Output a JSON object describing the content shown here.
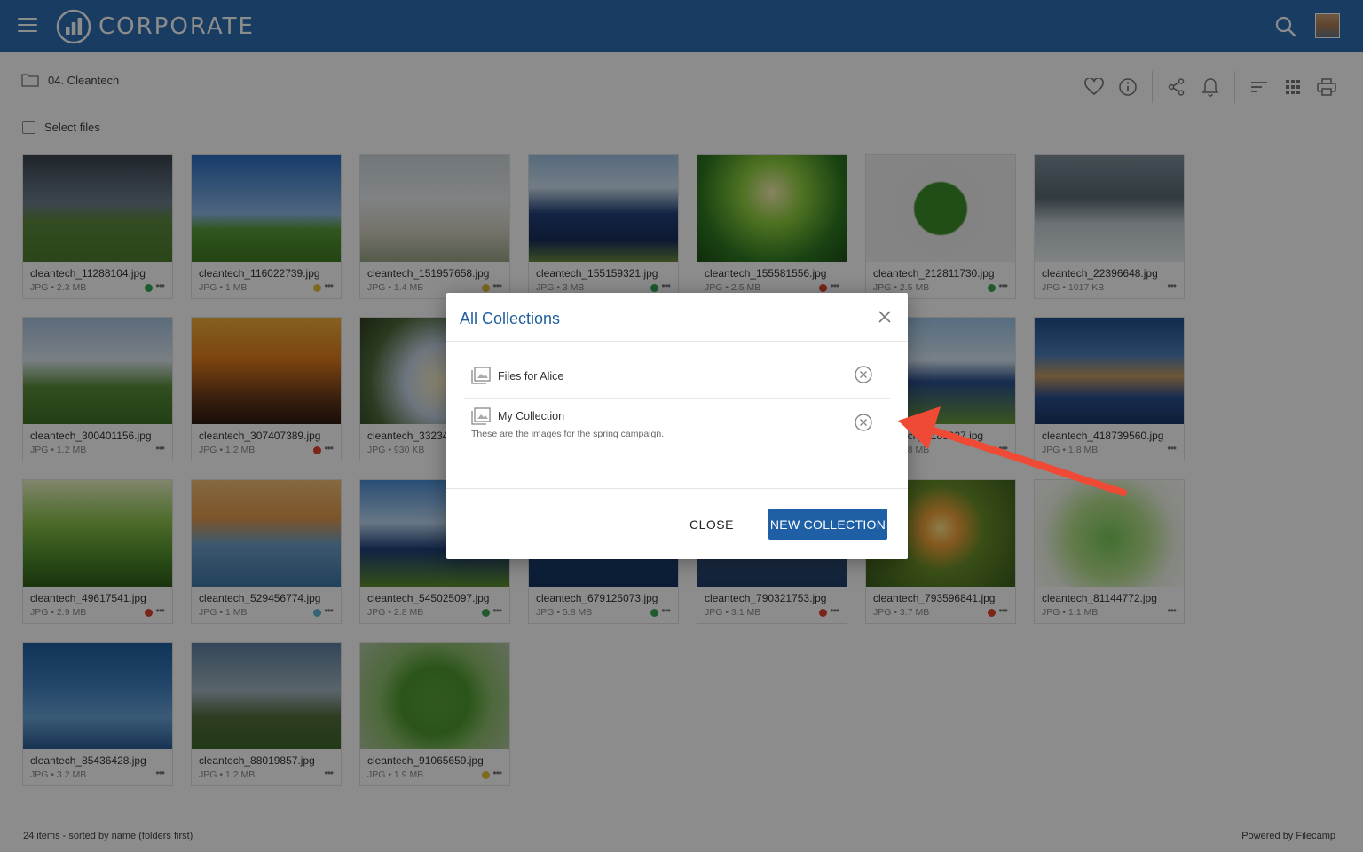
{
  "header": {
    "brand": "CORPORATE"
  },
  "breadcrumb": {
    "folder": "04. Cleantech"
  },
  "select_files": "Select files",
  "files": [
    {
      "name": "cleantech_11288104.jpg",
      "meta": "JPG • 2.3 MB",
      "dot": "#3aa655"
    },
    {
      "name": "cleantech_116022739.jpg",
      "meta": "JPG • 1 MB",
      "dot": "#e3c23a"
    },
    {
      "name": "cleantech_151957658.jpg",
      "meta": "JPG • 1.4 MB",
      "dot": "#e3c23a"
    },
    {
      "name": "cleantech_155159321.jpg",
      "meta": "JPG • 3 MB",
      "dot": "#3aa655"
    },
    {
      "name": "cleantech_155581556.jpg",
      "meta": "JPG • 2.5 MB",
      "dot": "#e0442e"
    },
    {
      "name": "cleantech_212811730.jpg",
      "meta": "JPG • 2.5 MB",
      "dot": "#3aa655"
    },
    {
      "name": "cleantech_22396648.jpg",
      "meta": "JPG • 1017 KB",
      "dot": ""
    },
    {
      "name": "cleantech_300401156.jpg",
      "meta": "JPG • 1.2 MB",
      "dot": ""
    },
    {
      "name": "cleantech_307407389.jpg",
      "meta": "JPG • 1.2 MB",
      "dot": "#e0442e"
    },
    {
      "name": "cleantech_33234",
      "meta": "JPG • 930 KB",
      "dot": ""
    },
    {
      "name": "",
      "meta": "",
      "dot": ""
    },
    {
      "name": "",
      "meta": "",
      "dot": ""
    },
    {
      "name": "cleantech_4188927.jpg",
      "meta": "JPG • 1.8 MB",
      "dot": ""
    },
    {
      "name": "cleantech_418739560.jpg",
      "meta": "JPG • 1.8 MB",
      "dot": ""
    },
    {
      "name": "cleantech_49617541.jpg",
      "meta": "JPG • 2.9 MB",
      "dot": "#e0442e"
    },
    {
      "name": "cleantech_529456774.jpg",
      "meta": "JPG • 1 MB",
      "dot": "#5fb8d6"
    },
    {
      "name": "cleantech_545025097.jpg",
      "meta": "JPG • 2.8 MB",
      "dot": "#3aa655"
    },
    {
      "name": "cleantech_679125073.jpg",
      "meta": "JPG • 5.8 MB",
      "dot": "#3aa655"
    },
    {
      "name": "cleantech_790321753.jpg",
      "meta": "JPG • 3.1 MB",
      "dot": "#e0442e"
    },
    {
      "name": "cleantech_793596841.jpg",
      "meta": "JPG • 3.7 MB",
      "dot": "#e0442e"
    },
    {
      "name": "cleantech_81144772.jpg",
      "meta": "JPG • 1.1 MB",
      "dot": ""
    },
    {
      "name": "cleantech_85436428.jpg",
      "meta": "JPG • 3.2 MB",
      "dot": ""
    },
    {
      "name": "cleantech_88019857.jpg",
      "meta": "JPG • 1.2 MB",
      "dot": ""
    },
    {
      "name": "cleantech_91065659.jpg",
      "meta": "JPG • 1.9 MB",
      "dot": "#e3c23a"
    }
  ],
  "footer": {
    "status": "24 items - sorted by name (folders first)",
    "powered": "Powered by Filecamp"
  },
  "modal": {
    "title": "All Collections",
    "collections": [
      {
        "name": "Files for Alice",
        "description": ""
      },
      {
        "name": "My Collection",
        "description": "These are the images for the spring campaign."
      }
    ],
    "close_label": "CLOSE",
    "new_label": "NEW COLLECTION"
  },
  "colors": {
    "header_bg": "#2f6fb3",
    "accent": "#1e5fa6",
    "annotation_arrow": "#ef4a35"
  }
}
